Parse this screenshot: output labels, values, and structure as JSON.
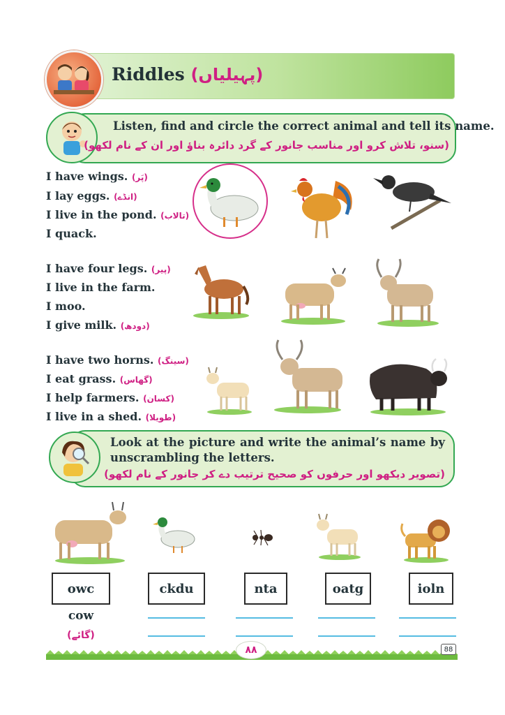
{
  "header": {
    "title": "Riddles",
    "title_urdu": "(پہیلیاں)"
  },
  "instruction1": {
    "english": "Listen, find and circle the correct animal and tell its name.",
    "urdu": "(سنو، تلاش کرو اور مناسب جانور کے گرد دائرہ بناؤ اور ان کے نام لکھو)"
  },
  "riddles": [
    {
      "lines": [
        {
          "en": "I have wings.",
          "ur": "(پَر)"
        },
        {
          "en": "I lay eggs.",
          "ur": "(انڈے)"
        },
        {
          "en": "I live in the pond.",
          "ur": "(تالاب)"
        },
        {
          "en": "I quack.",
          "ur": ""
        }
      ],
      "animals": [
        "duck",
        "rooster",
        "crow"
      ],
      "circled": "duck"
    },
    {
      "lines": [
        {
          "en": "I have four legs.",
          "ur": "(پیر)"
        },
        {
          "en": "I live in the farm.",
          "ur": ""
        },
        {
          "en": "I moo.",
          "ur": ""
        },
        {
          "en": "I give milk.",
          "ur": "(دودھ)"
        }
      ],
      "animals": [
        "horse",
        "cow",
        "ox"
      ]
    },
    {
      "lines": [
        {
          "en": "I have two horns.",
          "ur": "(سینگ)"
        },
        {
          "en": "I eat grass.",
          "ur": "(گھاس)"
        },
        {
          "en": "I help farmers.",
          "ur": "(کسان)"
        },
        {
          "en": "I live in a shed.",
          "ur": "(طویلا)"
        }
      ],
      "animals": [
        "goat",
        "ox",
        "yak"
      ]
    }
  ],
  "instruction2": {
    "english_line1": "Look at the picture and write the animal’s name by",
    "english_line2": "unscrambling the letters.",
    "urdu": "(تصویر دیکھو اور حرفوں کو صحیح ترتیب دے کر جانور کے نام لکھو)"
  },
  "unscramble": [
    {
      "animal": "cow",
      "scrambled": "owc",
      "answer": "cow",
      "answer_urdu": "(گائے)"
    },
    {
      "animal": "duck",
      "scrambled": "ckdu",
      "answer": "",
      "answer_urdu": ""
    },
    {
      "animal": "ant",
      "scrambled": "nta",
      "answer": "",
      "answer_urdu": ""
    },
    {
      "animal": "goat",
      "scrambled": "oatg",
      "answer": "",
      "answer_urdu": ""
    },
    {
      "animal": "lion",
      "scrambled": "ioln",
      "answer": "",
      "answer_urdu": ""
    }
  ],
  "footer": {
    "page_number": "88",
    "page_number_urdu": "۸۸"
  },
  "colors": {
    "accent_pink": "#cf1f83",
    "box_green": "#33a852",
    "line_blue": "#55bce2"
  }
}
